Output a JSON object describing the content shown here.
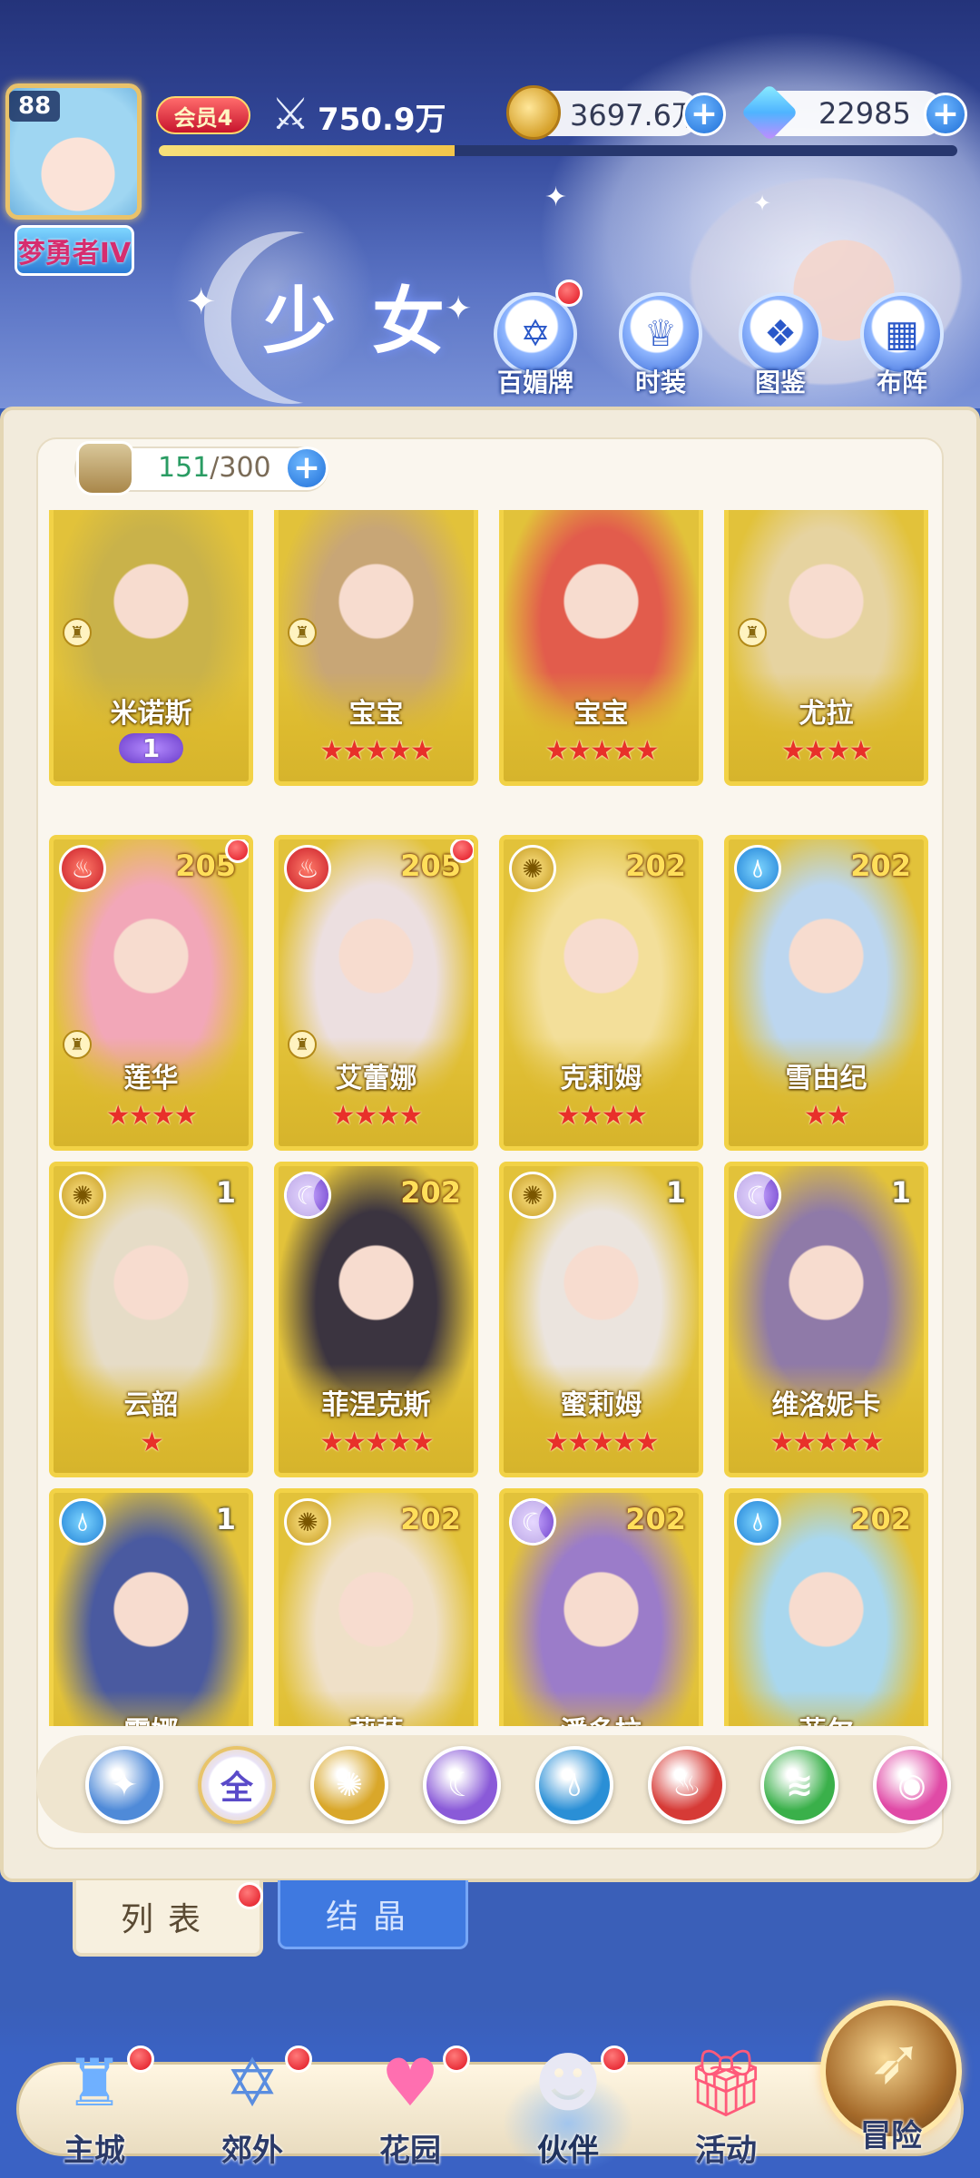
{
  "player": {
    "level": "88",
    "rank_title": "梦勇者IV",
    "vip_label": "会员4",
    "power": "750.9万",
    "exp_progress_percent": 37
  },
  "currencies": {
    "gold": "3697.6万",
    "gems": "22985"
  },
  "page_title": "少女",
  "menu": [
    {
      "label": "百媚牌",
      "icon": "card-icon",
      "has_red_dot": true
    },
    {
      "label": "时装",
      "icon": "outfit-icon",
      "has_red_dot": false
    },
    {
      "label": "图鉴",
      "icon": "book-icon",
      "has_red_dot": false
    },
    {
      "label": "布阵",
      "icon": "grid-icon",
      "has_red_dot": false
    }
  ],
  "capacity": {
    "current": "151",
    "sep": "/",
    "max": "300"
  },
  "cards": [
    {
      "name": "米诺斯",
      "stars": "",
      "level": "",
      "element": "",
      "badge": "1",
      "locked": true,
      "red_dot": false,
      "bg": "#c9b24a"
    },
    {
      "name": "宝宝",
      "stars": "★★★★★",
      "level": "",
      "element": "",
      "badge": "",
      "locked": true,
      "red_dot": false,
      "bg": "#c8a676"
    },
    {
      "name": "宝宝",
      "stars": "★★★★★",
      "level": "",
      "element": "",
      "badge": "",
      "locked": false,
      "red_dot": false,
      "bg": "#e25c4c"
    },
    {
      "name": "尤拉",
      "stars": "★★★★",
      "level": "",
      "element": "",
      "badge": "",
      "locked": true,
      "red_dot": false,
      "bg": "#e6d3a0"
    },
    {
      "name": "莲华",
      "stars": "★★★★",
      "level": "205",
      "element": "fire",
      "badge": "",
      "locked": true,
      "red_dot": true,
      "bg": "#f2a7b8"
    },
    {
      "name": "艾蕾娜",
      "stars": "★★★★",
      "level": "205",
      "element": "fire",
      "badge": "",
      "locked": true,
      "red_dot": true,
      "bg": "#ecdfe0"
    },
    {
      "name": "克莉姆",
      "stars": "★★★★",
      "level": "202",
      "element": "light",
      "badge": "",
      "locked": false,
      "red_dot": false,
      "bg": "#f3df9a"
    },
    {
      "name": "雪由纪",
      "stars": "★★",
      "level": "202",
      "element": "water",
      "badge": "",
      "locked": false,
      "red_dot": false,
      "bg": "#bcd6ef"
    },
    {
      "name": "云韶",
      "stars": "★",
      "level": "1",
      "element": "light",
      "badge": "",
      "locked": false,
      "red_dot": false,
      "bg": "#e6dcc7"
    },
    {
      "name": "菲涅克斯",
      "stars": "★★★★★",
      "level": "202",
      "element": "moon",
      "badge": "",
      "locked": false,
      "red_dot": false,
      "bg": "#3b3440"
    },
    {
      "name": "蜜莉姆",
      "stars": "★★★★★",
      "level": "1",
      "element": "light",
      "badge": "",
      "locked": false,
      "red_dot": false,
      "bg": "#ebe4de"
    },
    {
      "name": "维洛妮卡",
      "stars": "★★★★★",
      "level": "1",
      "element": "moon",
      "badge": "",
      "locked": false,
      "red_dot": false,
      "bg": "#8f7aa8"
    },
    {
      "name": "露娜",
      "stars": "★★★★★",
      "level": "1",
      "element": "water",
      "badge": "",
      "locked": false,
      "red_dot": false,
      "bg": "#4a5aa0"
    },
    {
      "name": "莉萨",
      "stars": "★★★★",
      "level": "202",
      "element": "light",
      "badge": "",
      "locked": false,
      "red_dot": false,
      "bg": "#efe0c8"
    },
    {
      "name": "潘多拉",
      "stars": "★★★",
      "level": "202",
      "element": "moon",
      "badge": "",
      "locked": false,
      "red_dot": false,
      "bg": "#9b7cc9"
    },
    {
      "name": "菲尔",
      "stars": "★★★",
      "level": "202",
      "element": "water",
      "badge": "",
      "locked": false,
      "red_dot": false,
      "bg": "#a9d7ee"
    }
  ],
  "filters": [
    {
      "label": "",
      "icon": "wing-icon",
      "bg": "#4f8ad8"
    },
    {
      "label": "全",
      "icon": "all-icon",
      "bg": "#ffffff"
    },
    {
      "label": "",
      "icon": "sun-icon",
      "bg": "#d9a72a"
    },
    {
      "label": "",
      "icon": "moon-icon",
      "bg": "#8a5ad8"
    },
    {
      "label": "",
      "icon": "water-icon",
      "bg": "#2a8fd6"
    },
    {
      "label": "",
      "icon": "fire-icon",
      "bg": "#d63a36"
    },
    {
      "label": "",
      "icon": "wind-icon",
      "bg": "#3ab04a"
    },
    {
      "label": "",
      "icon": "orb-icon",
      "bg": "#e04aa6"
    }
  ],
  "tabs": {
    "list": "列表",
    "crystal": "结晶"
  },
  "nav": [
    {
      "label": "主城",
      "icon": "castle-icon",
      "red_dot": true
    },
    {
      "label": "郊外",
      "icon": "gate-icon",
      "red_dot": true
    },
    {
      "label": "花园",
      "icon": "heart-icon",
      "red_dot": true
    },
    {
      "label": "伙伴",
      "icon": "companion-icon",
      "red_dot": true
    },
    {
      "label": "活动",
      "icon": "gift-icon",
      "red_dot": false
    },
    {
      "label": "冒险",
      "icon": "compass-icon",
      "red_dot": false
    }
  ]
}
